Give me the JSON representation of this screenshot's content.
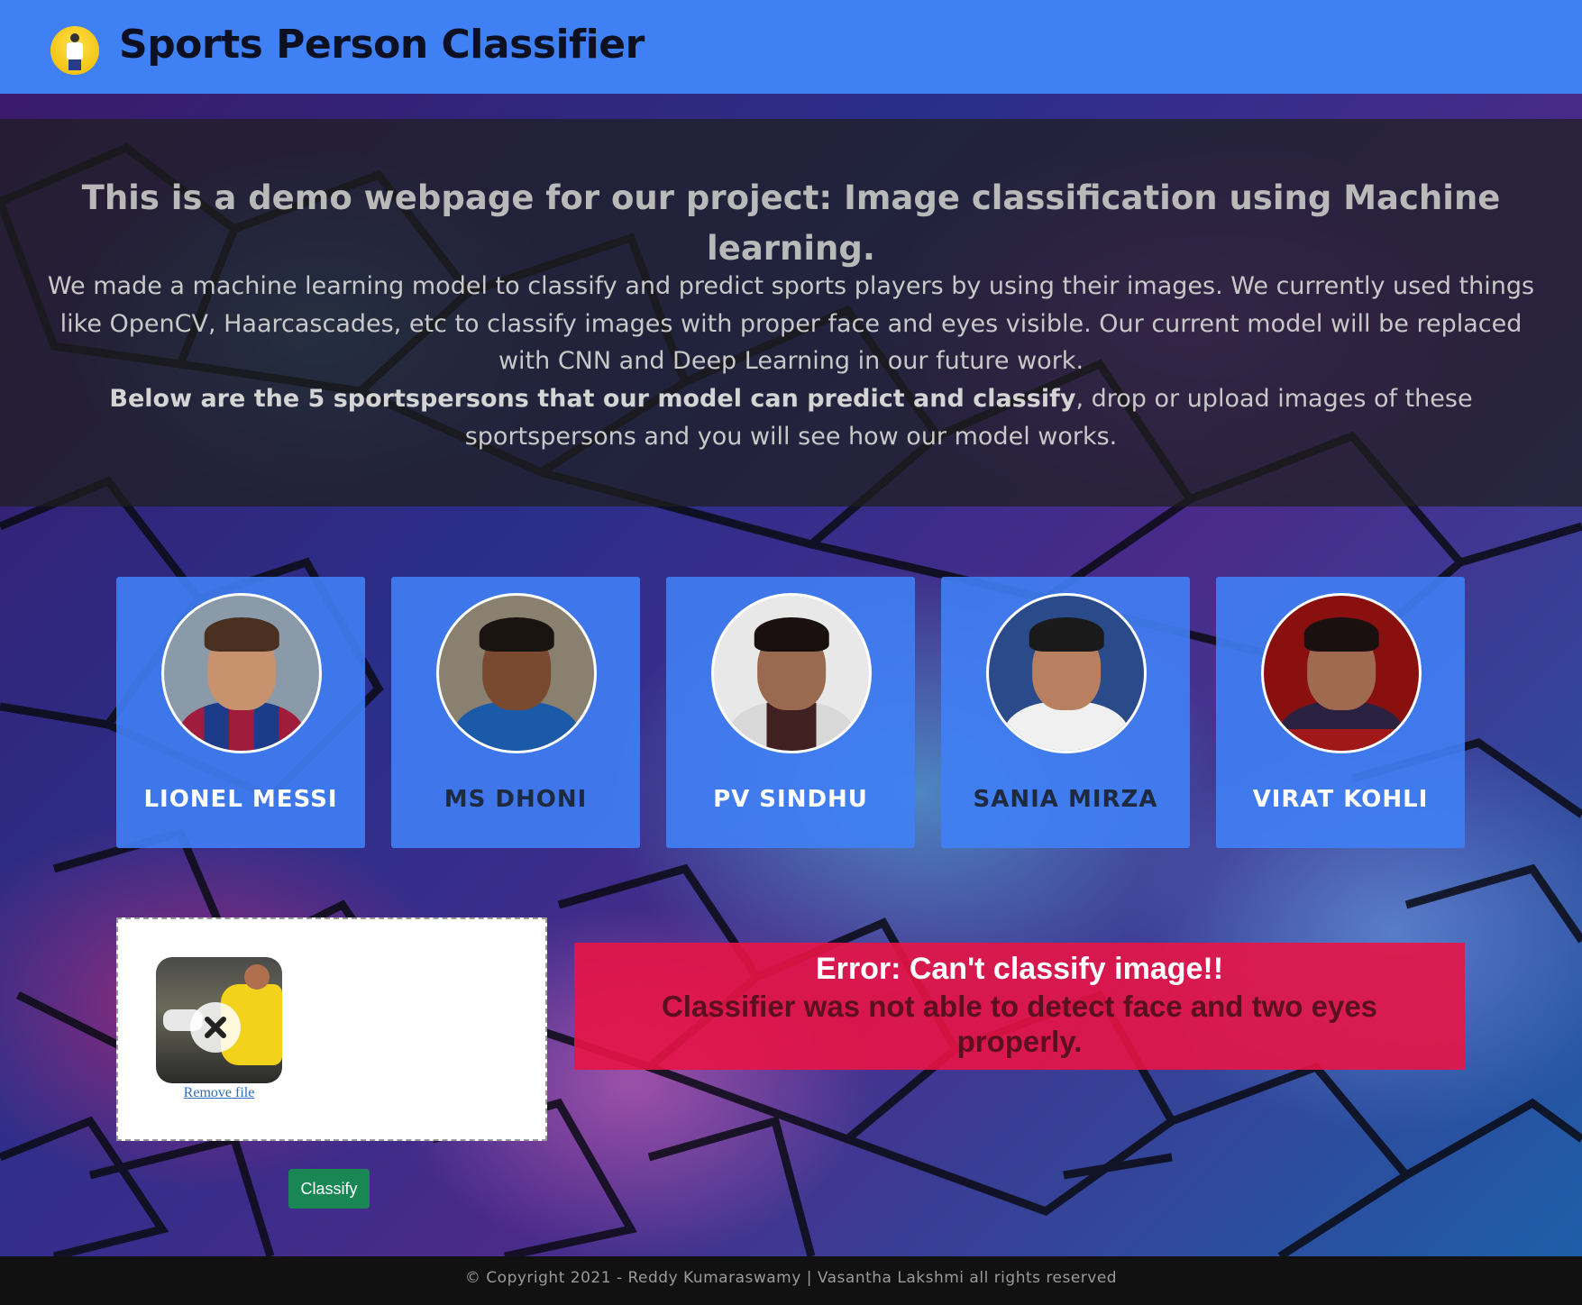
{
  "header": {
    "title": "Sports Person Classifier",
    "logo_icon": "sports-person-logo-icon",
    "background_color": "#4080f5"
  },
  "intro": {
    "heading": "This is a demo webpage for our project: Image classification using Machine learning.",
    "paragraph": "We made a machine learning model to classify and predict sports players by using their images. We currently used things like OpenCV, Haarcascades, etc to classify images with proper face and eyes visible. Our current model will be replaced with CNN and Deep Learning in our future work.",
    "instruction_bold": "Below are the 5 sportspersons that our model can predict and classify",
    "instruction_rest": ", drop or upload images of these sportspersons and you will see how our model works."
  },
  "players": [
    {
      "name": "LIONEL MESSI",
      "name_color": "#ffffff"
    },
    {
      "name": "MS DHONI",
      "name_color": "#1e2a40"
    },
    {
      "name": "PV SINDHU",
      "name_color": "#ffffff"
    },
    {
      "name": "SANIA MIRZA",
      "name_color": "#1e2a40"
    },
    {
      "name": "VIRAT KOHLI",
      "name_color": "#ffffff"
    }
  ],
  "upload": {
    "remove_label": "Remove file",
    "remove_icon": "close-icon",
    "classify_label": "Classify"
  },
  "error": {
    "title": "Error: Can't classify image!!",
    "message": "Classifier was not able to detect face and two eyes properly.",
    "background_color": "#e81446"
  },
  "footer": {
    "copyright": "© Copyright 2021 - Reddy Kumaraswamy | Vasantha Lakshmi all rights reserved"
  }
}
